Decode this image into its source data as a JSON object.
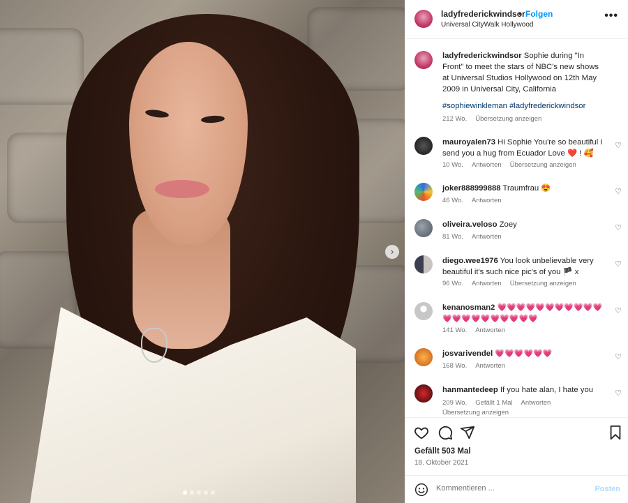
{
  "post": {
    "username": "ladyfrederickwindsor",
    "separator": "•",
    "follow_label": "Folgen",
    "location": "Universal CityWalk Hollywood",
    "more_icon": "more-horizontal-icon"
  },
  "caption": {
    "username": "ladyfrederickwindsor",
    "text": "Sophie during \"In Front\" to meet the stars of NBC's new shows at Universal Studios Hollywood on 12th May 2009 in Universal City, California",
    "hashtags": "#sophiewinkleman #ladyfrederickwindsor",
    "age": "212 Wo.",
    "translate": "Übersetzung anzeigen"
  },
  "comments": [
    {
      "username": "mauroyalen73",
      "text": "Hi Sophie You're so beautiful I send you a hug from Ecuador Love ❤️ ! 🥰",
      "age": "10 Wo.",
      "reply": "Antworten",
      "translate": "Übersetzung anzeigen"
    },
    {
      "username": "joker888999888",
      "text": "Traumfrau 😍",
      "age": "46 Wo.",
      "reply": "Antworten"
    },
    {
      "username": "oliveira.veloso",
      "text": "Zoey",
      "age": "81 Wo.",
      "reply": "Antworten"
    },
    {
      "username": "diego.wee1976",
      "text": "You look unbelievable very beautiful it's such nice pic's of you 🏴 x",
      "age": "96 Wo.",
      "reply": "Antworten",
      "translate": "Übersetzung anzeigen"
    },
    {
      "username": "kenanosman2",
      "text": "💗💗💗💗💗💗💗💗💗💗💗💗💗💗💗💗💗💗💗💗💗",
      "age": "141 Wo.",
      "reply": "Antworten"
    },
    {
      "username": "josvarivendel",
      "text": "💗💗💗💗💗💗",
      "age": "168 Wo.",
      "reply": "Antworten"
    },
    {
      "username": "hanmantedeep",
      "text": "If you hate alan, I hate you",
      "age": "209 Wo.",
      "likes": "Gefällt 1 Mal",
      "reply": "Antworten",
      "translate": "Übersetzung anzeigen"
    }
  ],
  "likes_label": "Gefällt 503 Mal",
  "date": "18. Oktober 2021",
  "compose": {
    "placeholder": "Kommentieren ...",
    "post_label": "Posten"
  },
  "colors": {
    "link_blue": "#0095f6",
    "heart_red": "#ed4956",
    "muted": "#737373"
  }
}
